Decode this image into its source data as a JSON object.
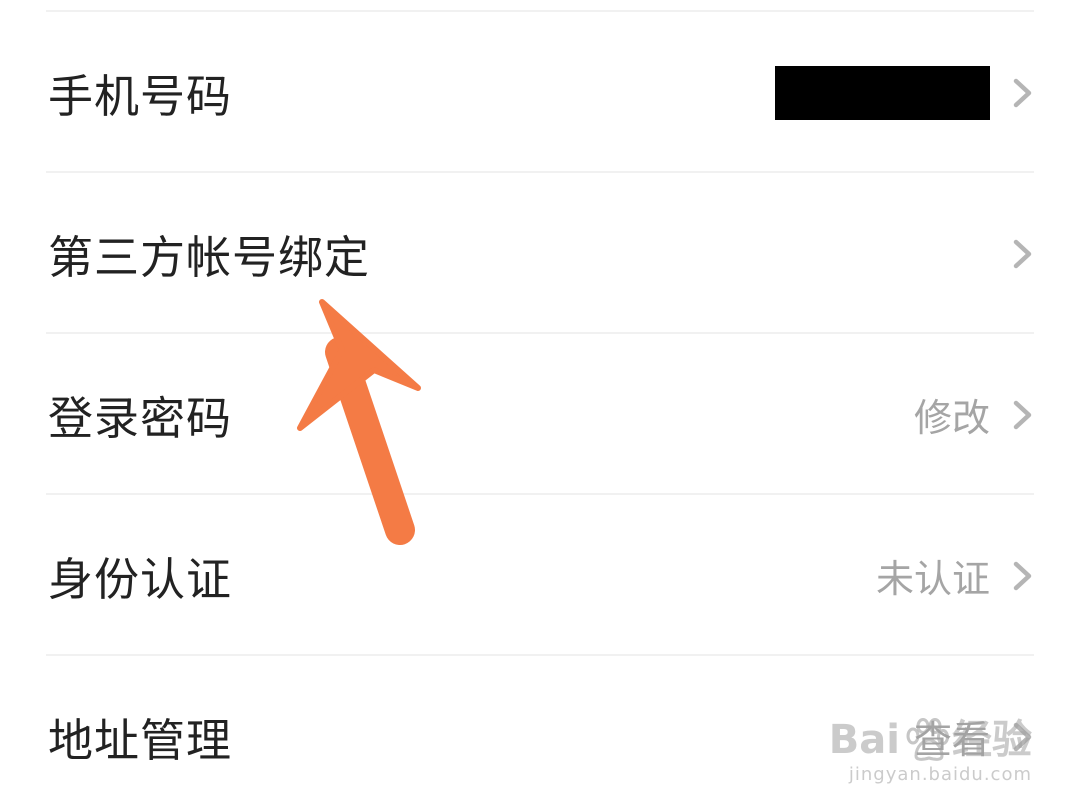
{
  "settings": {
    "rows": [
      {
        "label": "手机号码",
        "value": "",
        "value_redacted": true,
        "icon": "chevron-right-icon"
      },
      {
        "label": "第三方帐号绑定",
        "value": "",
        "icon": "chevron-right-icon"
      },
      {
        "label": "登录密码",
        "value": "修改",
        "icon": "chevron-right-icon"
      },
      {
        "label": "身份认证",
        "value": "未认证",
        "icon": "chevron-right-icon"
      },
      {
        "label": "地址管理",
        "value": "查看",
        "icon": "chevron-right-icon"
      }
    ]
  },
  "annotation": {
    "arrow_color": "#f47b45",
    "points_to": "第三方帐号绑定"
  },
  "watermark": {
    "left_text": "Bai",
    "right_text": "经验",
    "url": "jingyan.baidu.com",
    "icon": "baidu-paw-icon"
  },
  "colors": {
    "label": "#222222",
    "value": "#a5a5a5",
    "chevron": "#b5b5b5",
    "divider": "#f1f1f1"
  }
}
